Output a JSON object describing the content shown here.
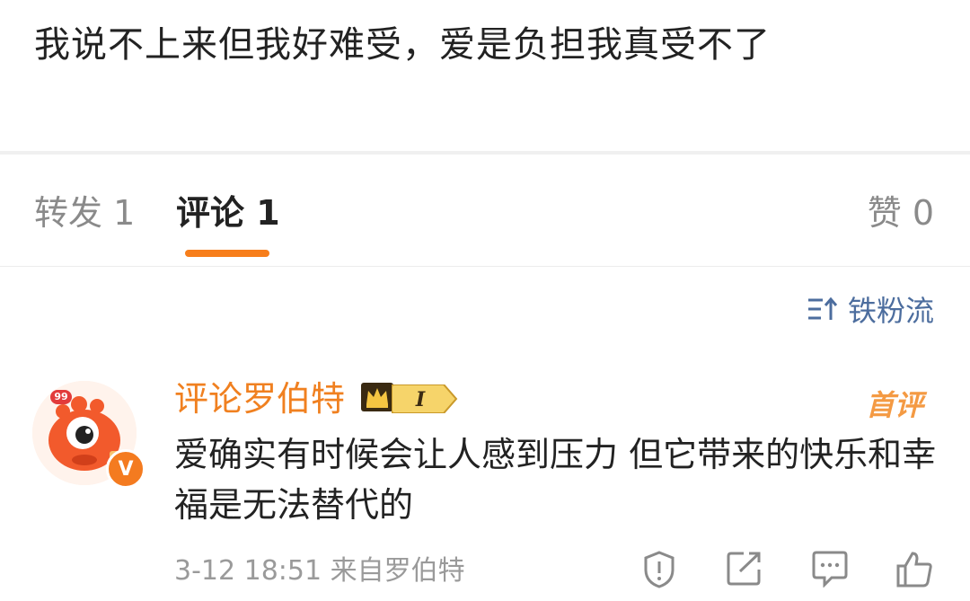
{
  "post": {
    "text": "我说不上来但我好难受，爱是负担我真受不了"
  },
  "tabs": {
    "repost": "转发 1",
    "comments": "评论 1",
    "likes": "赞 0"
  },
  "sort": {
    "label": "铁粉流",
    "icon": "sort-icon"
  },
  "comment": {
    "username": "评论罗伯特",
    "level_badge": "I",
    "avatar_badge_count": "99",
    "vip_mark": "V",
    "first_tag": "首评",
    "text": "爱确实有时候会让人感到压力 但它带来的快乐和幸福是无法替代的",
    "meta": "3-12 18:51 来自罗伯特",
    "actions": [
      "report-icon",
      "share-icon",
      "comment-icon",
      "like-icon"
    ]
  },
  "colors": {
    "accent": "#f77e1b",
    "username": "#f08020",
    "link": "#4c6d9e"
  }
}
